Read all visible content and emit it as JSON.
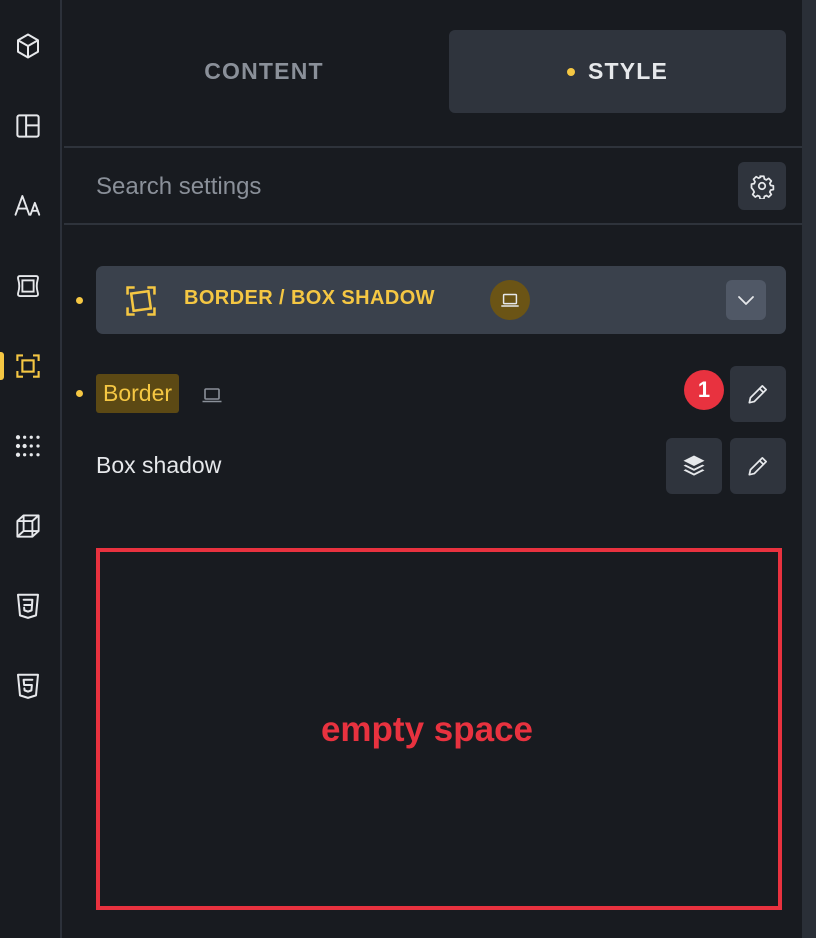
{
  "sidebar": {
    "items": [
      {
        "name": "cube-icon"
      },
      {
        "name": "layout-icon"
      },
      {
        "name": "typography-icon"
      },
      {
        "name": "spacing-icon"
      },
      {
        "name": "border-icon",
        "active": true
      },
      {
        "name": "grid-dots-icon"
      },
      {
        "name": "transform-icon"
      },
      {
        "name": "css3-icon"
      },
      {
        "name": "html5-icon"
      }
    ]
  },
  "tabs": {
    "content_label": "CONTENT",
    "style_label": "STYLE",
    "active": "style"
  },
  "search": {
    "placeholder": "Search settings",
    "settings_icon": "gear-icon"
  },
  "group": {
    "title": "BORDER / BOX SHADOW",
    "icon": "border-frame-icon",
    "badge_icon": "laptop-icon",
    "toggle_icon": "chevron-down-icon"
  },
  "rows": {
    "border": {
      "label": "Border",
      "device_icon": "laptop-icon",
      "notification_count": "1",
      "edit_icon": "pencil-icon"
    },
    "box_shadow": {
      "label": "Box shadow",
      "layers_icon": "layers-icon",
      "edit_icon": "pencil-icon"
    }
  },
  "annotation": {
    "label": "empty space"
  },
  "colors": {
    "background": "#181b20",
    "accent": "#f5c743",
    "panel": "#2f343d",
    "annotation": "#e8323f",
    "text": "#e6e8eb",
    "muted": "#8a9099"
  }
}
